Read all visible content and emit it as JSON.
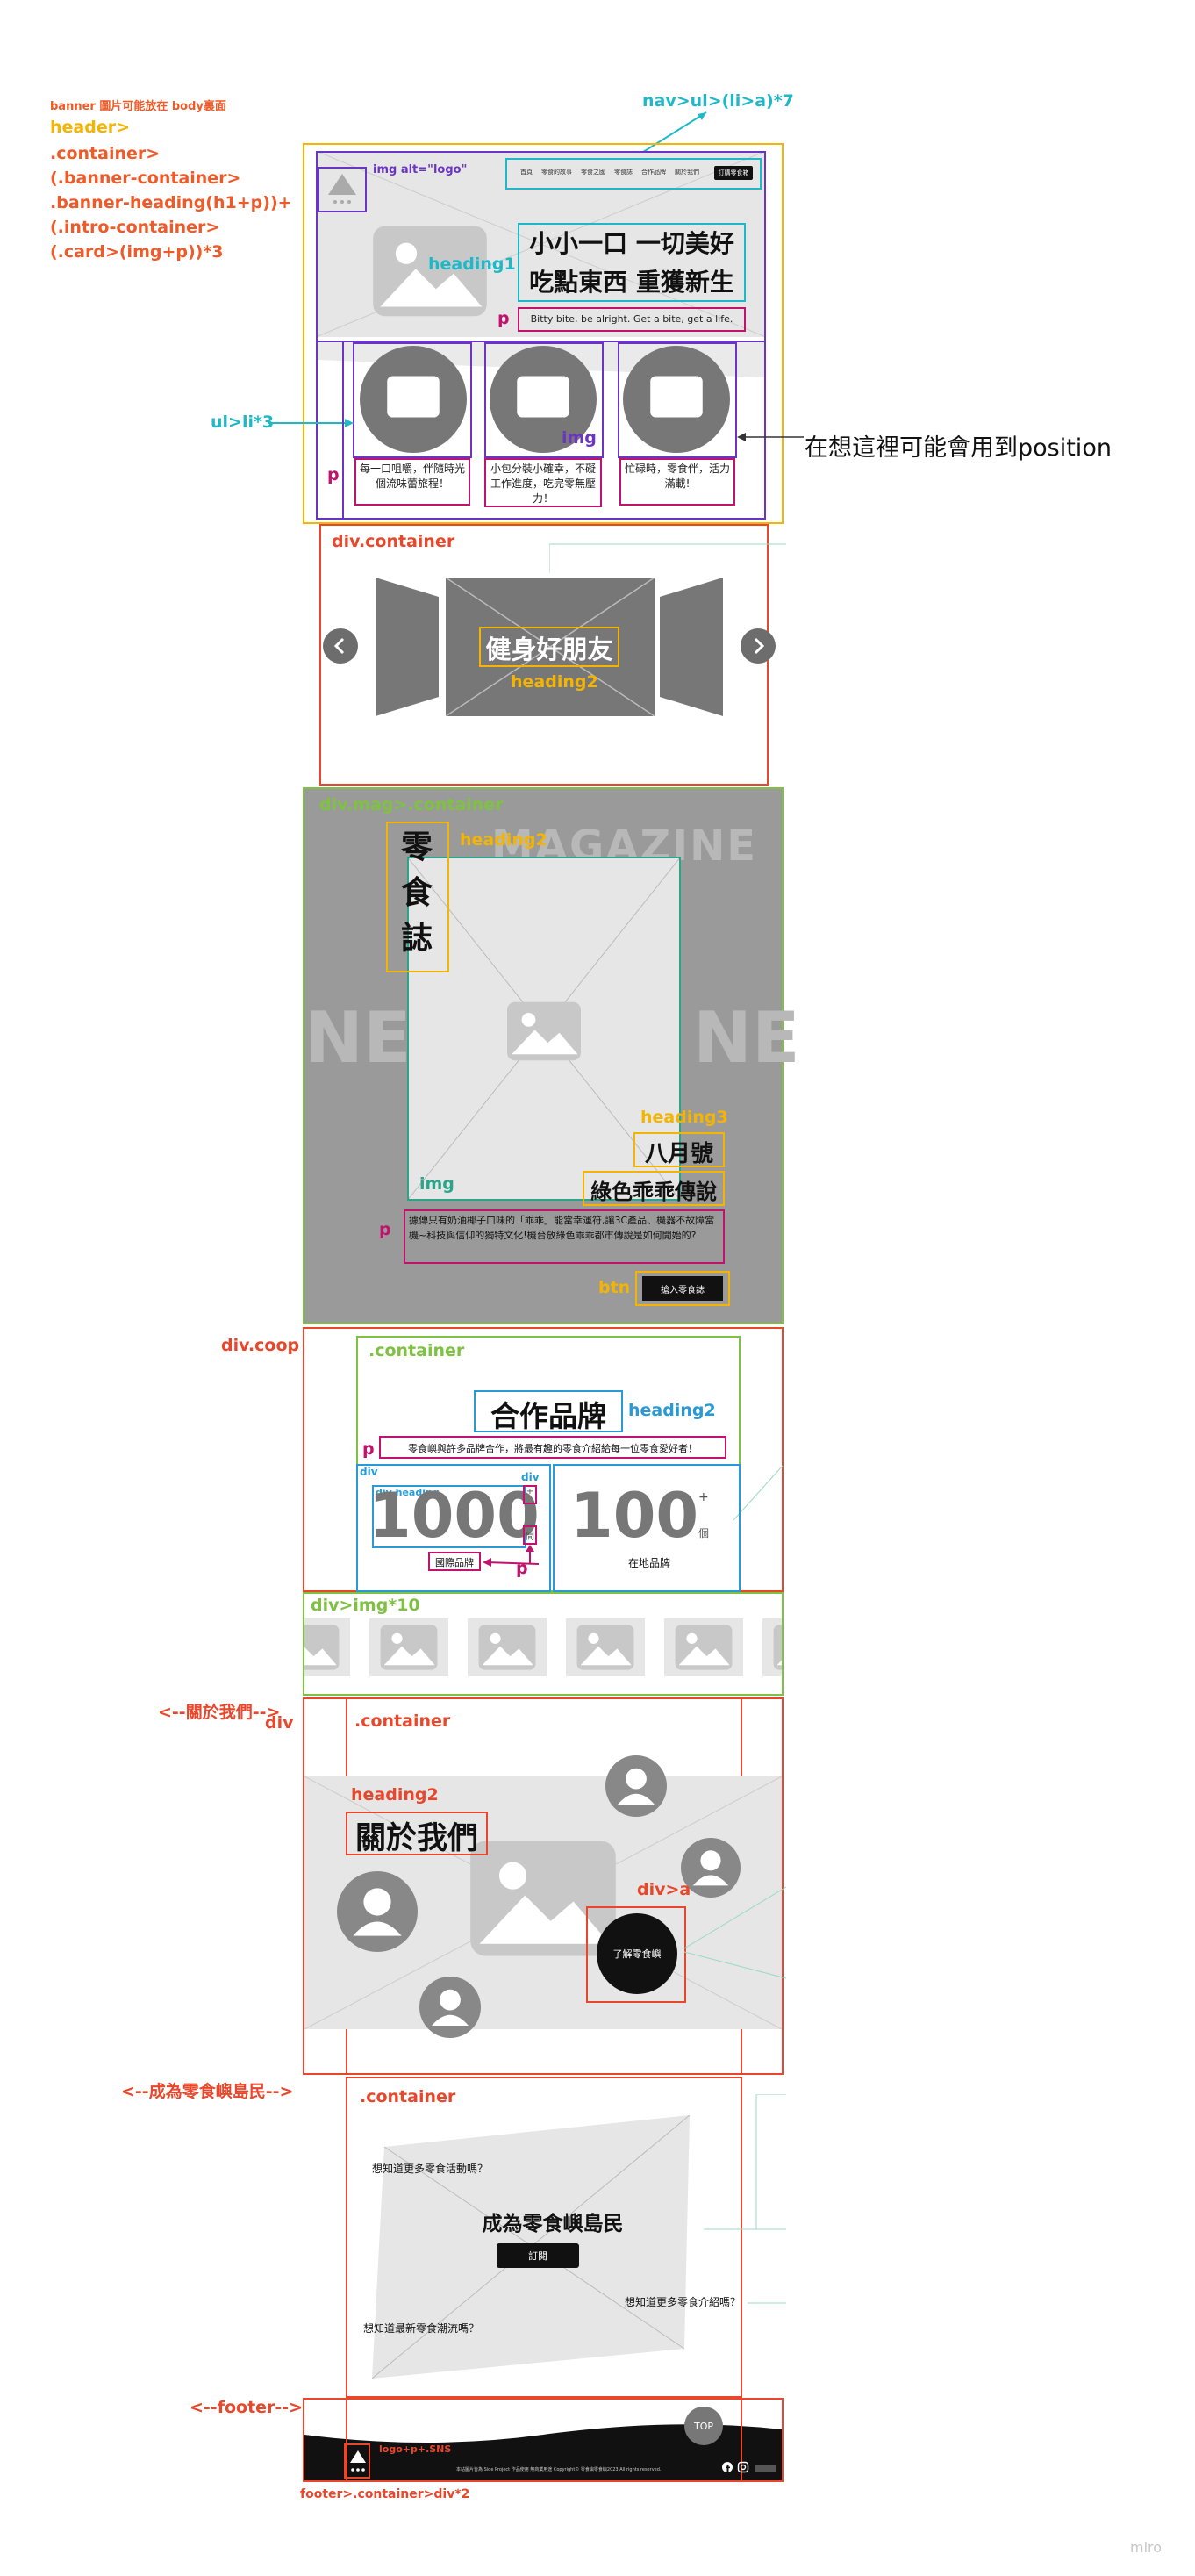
{
  "annotations": {
    "banner_note": "banner 圖片可能放在 body裏面",
    "header_tree": [
      "header>",
      ".container>",
      "(.banner-container>",
      ".banner-heading(h1+p))+",
      "(.intro-container>",
      "(.card>(img+p))*3"
    ],
    "nav": "nav>ul>(li>a)*7",
    "img_logo": "img alt=\"logo\"",
    "heading1": "heading1",
    "p": "p",
    "ul_li": "ul>li*3",
    "img": "img",
    "position_note": "在想這裡可能會用到position",
    "div_container": "div.container",
    "heading2": "heading2",
    "div_mag": "div.mag>.container",
    "heading3": "heading3",
    "btn": "btn",
    "div_coop": "div.coop",
    "container": ".container",
    "div": "div",
    "div_img": "div>img*10",
    "about_comment": "<--關於我們-->",
    "div_a": "div>a",
    "member_comment": "<--成為零食嶼島民-->",
    "footer_comment": "<--footer-->",
    "logo_sns": "logo+p+.SNS",
    "footer_tree": "footer>.container>div*2",
    "watermark": "miro"
  },
  "header": {
    "nav_links": [
      "首頁",
      "零食的故事",
      "零食之國",
      "零食誌",
      "合作品牌",
      "關於我們"
    ],
    "nav_button": "訂購零食箱",
    "title_line1": "小小一口 一切美好",
    "title_line2": "吃點東西 重獲新生",
    "subtitle": "Bitty bite, be alright. Get a bite, get a life.",
    "cards": [
      "每一口咀嚼，伴隨時光個流味蕾旅程！",
      "小包分裝小確幸，不礙工作進度，吃完零無壓力！",
      "忙碌時，零食伴，活力滿載!"
    ]
  },
  "carousel": {
    "title": "健身好朋友"
  },
  "magazine": {
    "bg_word": "MAGAZINE",
    "side_word": "NE",
    "title": "零食誌",
    "month": "八月號",
    "subtitle": "綠色乖乖傳說",
    "desc": "據傳只有奶油椰子口味的「乖乖」能當幸運符,讓3C產品、機器不故障當機~科技與信仰的獨特文化!機台放綠色乖乖都市傳說是如何開始的?",
    "button": "搶入零食誌"
  },
  "coop": {
    "title": "合作品牌",
    "desc": "零食嶼與許多品牌合作，將最有趣的零食介紹給每一位零食愛好者！",
    "stat1_number": "1000",
    "stat1_mini_label": "div heading",
    "stat1_unit_chars": [
      "+",
      "間"
    ],
    "stat1_label": "國際品牌",
    "stat2_number": "100",
    "stat2_plus": "+",
    "stat2_unit": "個",
    "stat2_label": "在地品牌"
  },
  "about": {
    "title": "關於我們",
    "button": "了解零食嶼"
  },
  "member": {
    "q1": "想知道更多零食活動嗎？",
    "title": "成為零食嶼島民",
    "button": "訂閱",
    "q2": "想知道更多零食介紹嗎？",
    "q3": "想知道最新零食潮流嗎？"
  },
  "footer": {
    "top": "TOP",
    "copyright": "本站圖片皆為 Side Project 作品使用 無商業用途 Copyright© 零食嶼零食嶼2023 All rights reserved."
  },
  "colors": {
    "orange": "#ef5a28",
    "yellow": "#f4b400",
    "cyan": "#1fb8c9",
    "purple": "#6a35c2",
    "magenta": "#c0136e",
    "red": "#e8472b",
    "green": "#7fc241",
    "teal": "#2aa58a",
    "blue": "#2a9ad6"
  }
}
